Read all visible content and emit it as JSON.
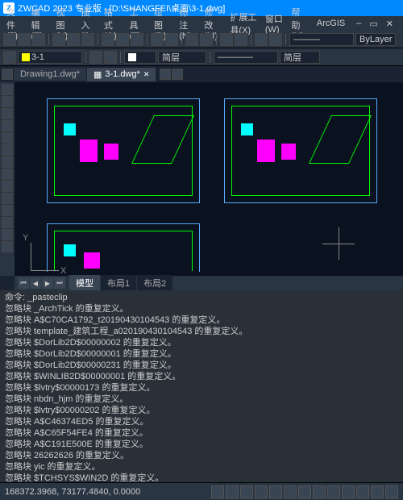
{
  "title": "ZWCAD 2023 专业版 - [D:\\SHANGFEI\\桌面\\3-1.dwg]",
  "menu": {
    "file": "文件(F)",
    "edit": "编辑(E)",
    "view": "视图(V)",
    "insert": "插入(I)",
    "format": "格式(O)",
    "tools": "工具(T)",
    "draw": "绘图(D)",
    "label": "标注(N)",
    "modify": "修改(M)",
    "ext": "扩展工具(X)",
    "window": "窗口(W)",
    "help": "帮助(H)",
    "arcgis": "ArcGIS"
  },
  "toolbar": {
    "layer_current": "3-1",
    "layer_dropdown": "简层",
    "layer_dd2": "简层",
    "bylayer": "ByLayer"
  },
  "doctabs": {
    "tab1": "Drawing1.dwg*",
    "tab2": "3-1.dwg*"
  },
  "ucs": {
    "x": "X",
    "y": "Y"
  },
  "layouttabs": {
    "model": "模型",
    "layout1": "布局1",
    "layout2": "布局2"
  },
  "cmd": {
    "prompt": "命令:",
    "paste": "_pasteclip",
    "l0": "忽略块 _ArchTick 的重复定义。",
    "l1": "忽略块 A$C70CA1792_t20190430104543 的重复定义。",
    "l2": "忽略块 template_建筑工程_a020190430104543 的重复定义。",
    "l3": "忽略块 $DorLib2D$00000002 的重复定义。",
    "l4": "忽略块 $DorLib2D$00000001 的重复定义。",
    "l5": "忽略块 $DorLib2D$00000231 的重复定义。",
    "l6": "忽略块 $WINLIB2D$00000001 的重复定义。",
    "l7": "忽略块 $lvtry$00000173 的重复定义。",
    "l8": "忽略块 nbdn_hjm 的重复定义。",
    "l9": "忽略块 $lvtry$00000202 的重复定义。",
    "l10": "忽略块 A$C46374ED5 的重复定义。",
    "l11": "忽略块 A$C65F54FE4 的重复定义。",
    "l12": "忽略块 A$C191E500E 的重复定义。",
    "l13": "忽略块 26262626 的重复定义。",
    "l14": "忽略块 yic 的重复定义。",
    "l15": "忽略块 $TCHSYS$WIN2D 的重复定义。"
  },
  "status": {
    "coords": "168372.3968, 73177.4840, 0.0000"
  },
  "wincontrols": {
    "min": "–",
    "max": "▭",
    "close": "✕"
  }
}
